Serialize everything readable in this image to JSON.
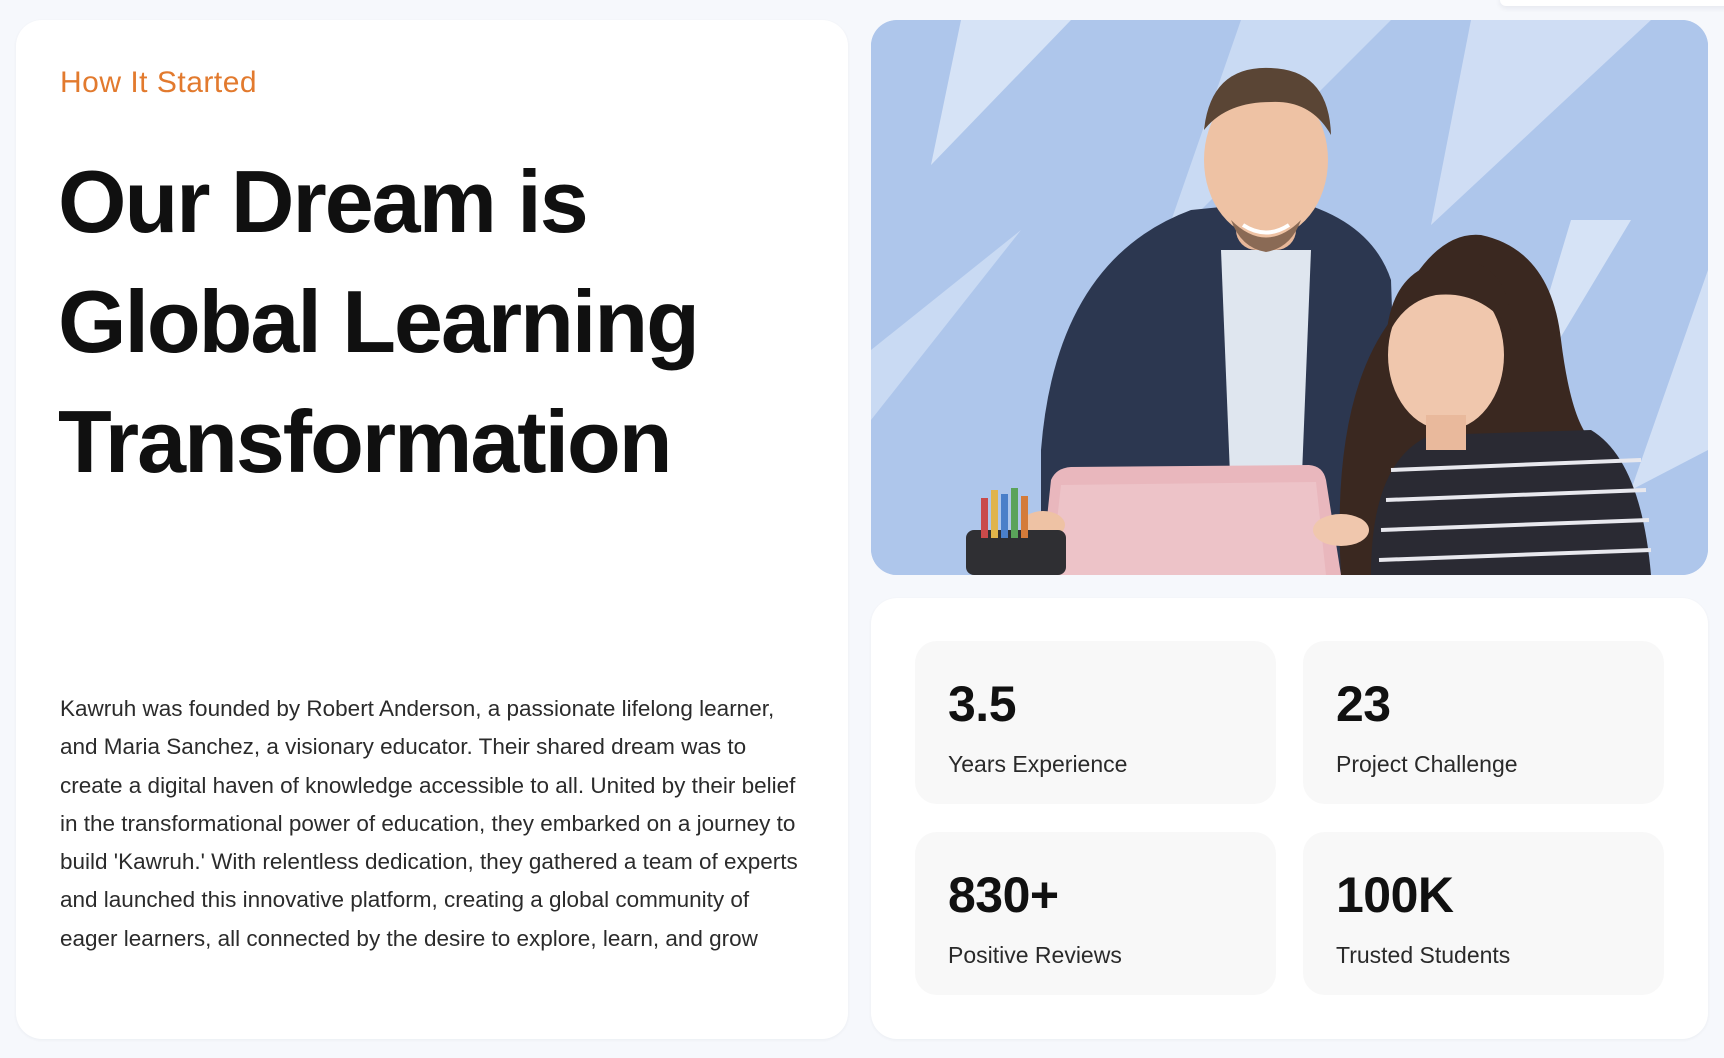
{
  "story": {
    "eyebrow": "How It Started",
    "headline_lines": [
      "Our Dream is",
      "Global Learning",
      "Transformation"
    ],
    "body": "Kawruh was founded by Robert Anderson, a passionate lifelong learner, and Maria Sanchez, a visionary educator. Their shared dream was to create a digital haven of knowledge accessible to all. United by their belief in the transformational power of education, they embarked on a journey to build 'Kawruh.' With relentless dedication, they gathered a team of experts and launched this innovative platform, creating a global community of eager learners, all connected by the desire to explore, learn, and grow"
  },
  "stats": [
    {
      "value": "3.5",
      "label": "Years Experience"
    },
    {
      "value": "23",
      "label": "Project Challenge"
    },
    {
      "value": "830+",
      "label": "Positive Reviews"
    },
    {
      "value": "100K",
      "label": "Trusted Students"
    }
  ],
  "colors": {
    "accent": "#e27a2e",
    "hero_background": "#aec6eb",
    "page_background": "#f6f8fc",
    "card_background": "#ffffff",
    "stat_background": "#f8f8f8"
  }
}
